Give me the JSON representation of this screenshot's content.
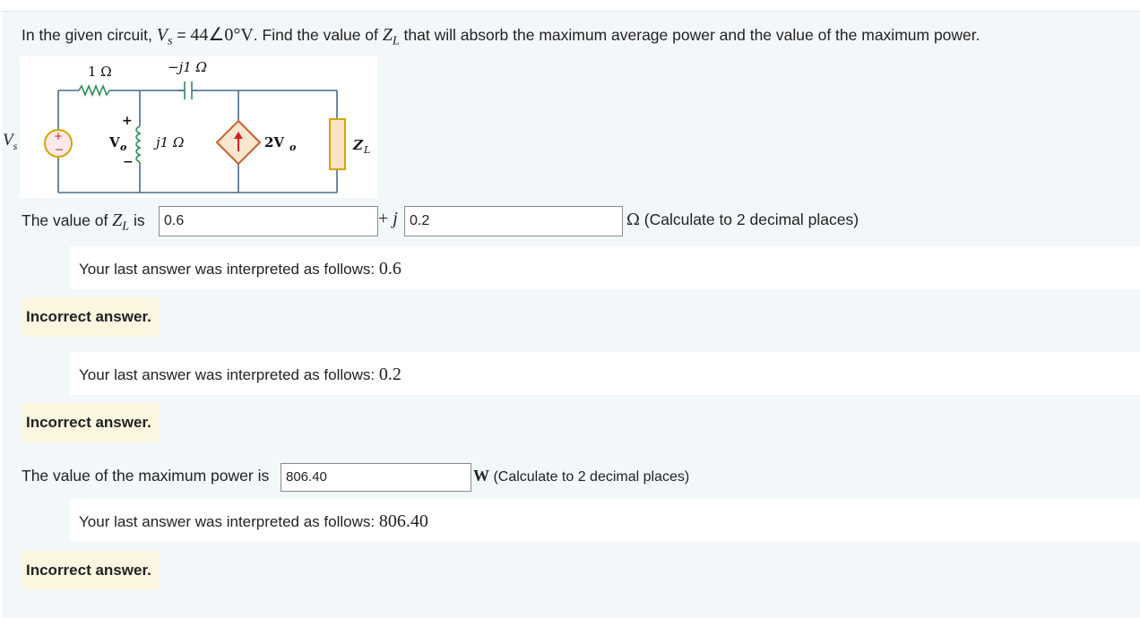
{
  "question": {
    "intro": "In the given circuit, ",
    "vs_symbol": "V",
    "vs_sub": "s",
    "vs_eq": " = ",
    "vs_value": "44∠0°V",
    "mid": ". Find the value of ",
    "zl_symbol": "Z",
    "zl_sub": "L",
    "rest": " that will absorb the maximum average power and the value of the maximum power."
  },
  "circuit": {
    "r1_label": "1 Ω",
    "cap_label": "−j1 Ω",
    "ind_label": "j1 Ω",
    "vo_label": "V",
    "vo_sub": "o",
    "plus": "+",
    "minus": "−",
    "dep_label": "2V",
    "dep_sub": "o",
    "zl_label": "Z",
    "zl_sub": "L",
    "vs_label": "V",
    "vs_sub": "s"
  },
  "zl_answer": {
    "label_prefix": "The value of ",
    "label_z": "Z",
    "label_sub": "L",
    "label_suffix": " is",
    "real_value": "0.6",
    "plus_j": "+ ",
    "j": "j",
    "imag_value": "0.2",
    "unit": "Ω",
    "note": " (Calculate to 2 decimal places)"
  },
  "feedback": [
    {
      "interp_text": "Your last answer was interpreted as follows: ",
      "interp_value": "0.6",
      "status": "Incorrect answer."
    },
    {
      "interp_text": "Your last answer was interpreted as follows: ",
      "interp_value": "0.2",
      "status": "Incorrect answer."
    },
    {
      "interp_text": "Your last answer was interpreted as follows: ",
      "interp_value": "806.40",
      "status": "Incorrect answer."
    }
  ],
  "power_answer": {
    "label": "The value of the maximum power is",
    "value": "806.40",
    "unit": "W",
    "note": " (Calculate to 2 decimal places)"
  }
}
